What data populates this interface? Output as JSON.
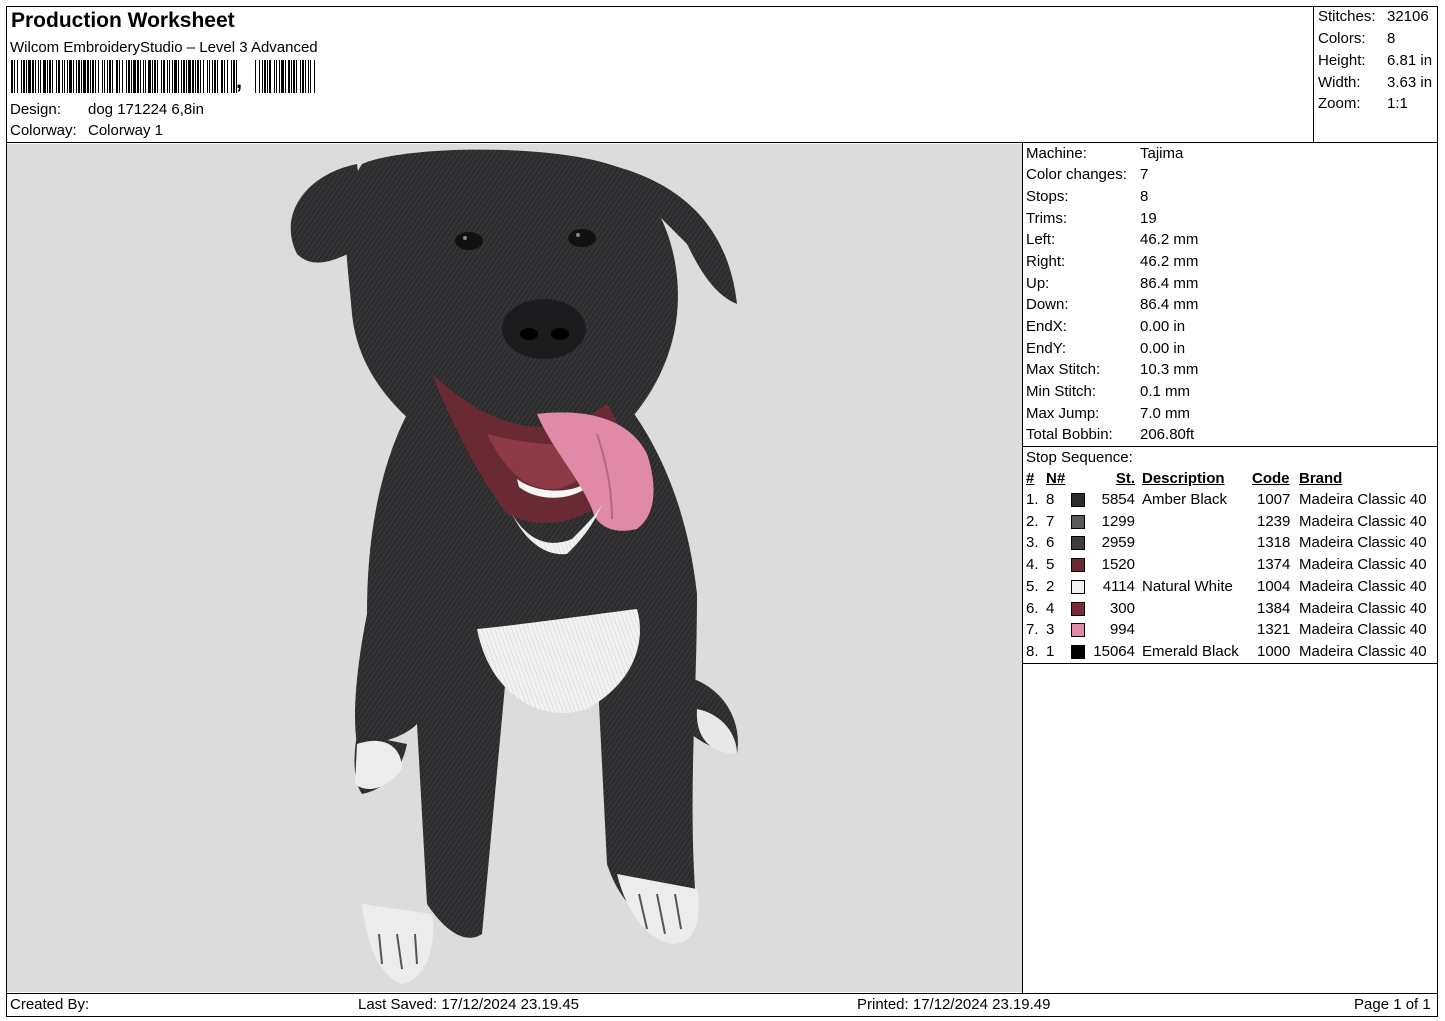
{
  "header": {
    "title": "Production Worksheet",
    "software": "Wilcom EmbroideryStudio – Level 3 Advanced",
    "barcode_suffix": ",",
    "design_label": "Design:",
    "design_value": "dog 171224 6,8in",
    "colorway_label": "Colorway:",
    "colorway_value": "Colorway 1"
  },
  "summary": [
    {
      "label": "Stitches:",
      "value": "32106"
    },
    {
      "label": "Colors:",
      "value": "8"
    },
    {
      "label": "Height:",
      "value": "6.81 in"
    },
    {
      "label": "Width:",
      "value": "3.63 in"
    },
    {
      "label": "Zoom:",
      "value": "1:1"
    }
  ],
  "details": [
    {
      "label": "Machine:",
      "value": "Tajima"
    },
    {
      "label": "Color changes:",
      "value": "7"
    },
    {
      "label": "Stops:",
      "value": "8"
    },
    {
      "label": "Trims:",
      "value": "19"
    },
    {
      "label": "Left:",
      "value": "46.2 mm"
    },
    {
      "label": "Right:",
      "value": "46.2 mm"
    },
    {
      "label": "Up:",
      "value": "86.4 mm"
    },
    {
      "label": "Down:",
      "value": "86.4 mm"
    },
    {
      "label": "EndX:",
      "value": "0.00 in"
    },
    {
      "label": "EndY:",
      "value": "0.00 in"
    },
    {
      "label": "Max Stitch:",
      "value": "10.3 mm"
    },
    {
      "label": "Min Stitch:",
      "value": "0.1 mm"
    },
    {
      "label": "Max Jump:",
      "value": "7.0 mm"
    },
    {
      "label": "Total Bobbin:",
      "value": "206.80ft"
    }
  ],
  "stop_sequence": {
    "title": "Stop Sequence:",
    "headers": {
      "num": "#",
      "n": "N#",
      "st": "St.",
      "description": "Description",
      "code": "Code",
      "brand": "Brand"
    },
    "rows": [
      {
        "num": "1.",
        "n": "8",
        "color": "#2b2b2b",
        "st": "5854",
        "description": "Amber Black",
        "code": "1007",
        "brand": "Madeira Classic 40"
      },
      {
        "num": "2.",
        "n": "7",
        "color": "#5a5a5c",
        "st": "1299",
        "description": "",
        "code": "1239",
        "brand": "Madeira Classic 40"
      },
      {
        "num": "3.",
        "n": "6",
        "color": "#3c3c3e",
        "st": "2959",
        "description": "",
        "code": "1318",
        "brand": "Madeira Classic 40"
      },
      {
        "num": "4.",
        "n": "5",
        "color": "#6a2a33",
        "st": "1520",
        "description": "",
        "code": "1374",
        "brand": "Madeira Classic 40"
      },
      {
        "num": "5.",
        "n": "2",
        "color": "#f0f0f0",
        "st": "4114",
        "description": "Natural White",
        "code": "1004",
        "brand": "Madeira Classic 40"
      },
      {
        "num": "6.",
        "n": "4",
        "color": "#7a2a38",
        "st": "300",
        "description": "",
        "code": "1384",
        "brand": "Madeira Classic 40"
      },
      {
        "num": "7.",
        "n": "3",
        "color": "#e08aa8",
        "st": "994",
        "description": "",
        "code": "1321",
        "brand": "Madeira Classic 40"
      },
      {
        "num": "8.",
        "n": "1",
        "color": "#000000",
        "st": "15064",
        "description": "Emerald Black",
        "code": "1000",
        "brand": "Madeira Classic 40"
      }
    ]
  },
  "footer": {
    "created_by": "Created By:",
    "last_saved": "Last Saved: 17/12/2024 23.19.45",
    "printed": "Printed: 17/12/2024 23.19.49",
    "page": "Page 1 of 1"
  }
}
